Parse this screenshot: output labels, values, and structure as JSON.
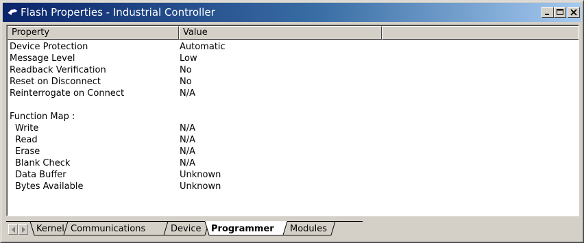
{
  "window": {
    "title": "Flash Properties - Industrial Controller",
    "buttons": {
      "minimize": "minimize",
      "maximize": "maximize",
      "close": "close"
    }
  },
  "table": {
    "columns": [
      "Property",
      "Value",
      ""
    ],
    "rows": [
      {
        "property": "Device Protection",
        "value": "Automatic"
      },
      {
        "property": "Message Level",
        "value": "Low"
      },
      {
        "property": "Readback Verification",
        "value": "No"
      },
      {
        "property": "Reset on Disconnect",
        "value": "No"
      },
      {
        "property": "Reinterrogate on Connect",
        "value": "N/A"
      },
      {
        "property": "",
        "value": ""
      },
      {
        "property": "Function Map :",
        "value": ""
      },
      {
        "property": "Write",
        "value": "N/A"
      },
      {
        "property": "Read",
        "value": "N/A"
      },
      {
        "property": "Erase",
        "value": "N/A"
      },
      {
        "property": "Blank Check",
        "value": "N/A"
      },
      {
        "property": "Data Buffer",
        "value": "Unknown"
      },
      {
        "property": "Bytes Available",
        "value": "Unknown"
      }
    ]
  },
  "tabs": {
    "items": [
      "Kernel",
      "Communications",
      "Device",
      "Programmer",
      "Modules"
    ],
    "active": "Programmer"
  },
  "icons": {
    "title": "flash-chip-icon",
    "scroll_left": "triangle-left-icon",
    "scroll_right": "triangle-right-icon"
  },
  "colors": {
    "titlebar_start": "#0a246a",
    "titlebar_end": "#a6caf0",
    "face": "#d4d0c8"
  }
}
